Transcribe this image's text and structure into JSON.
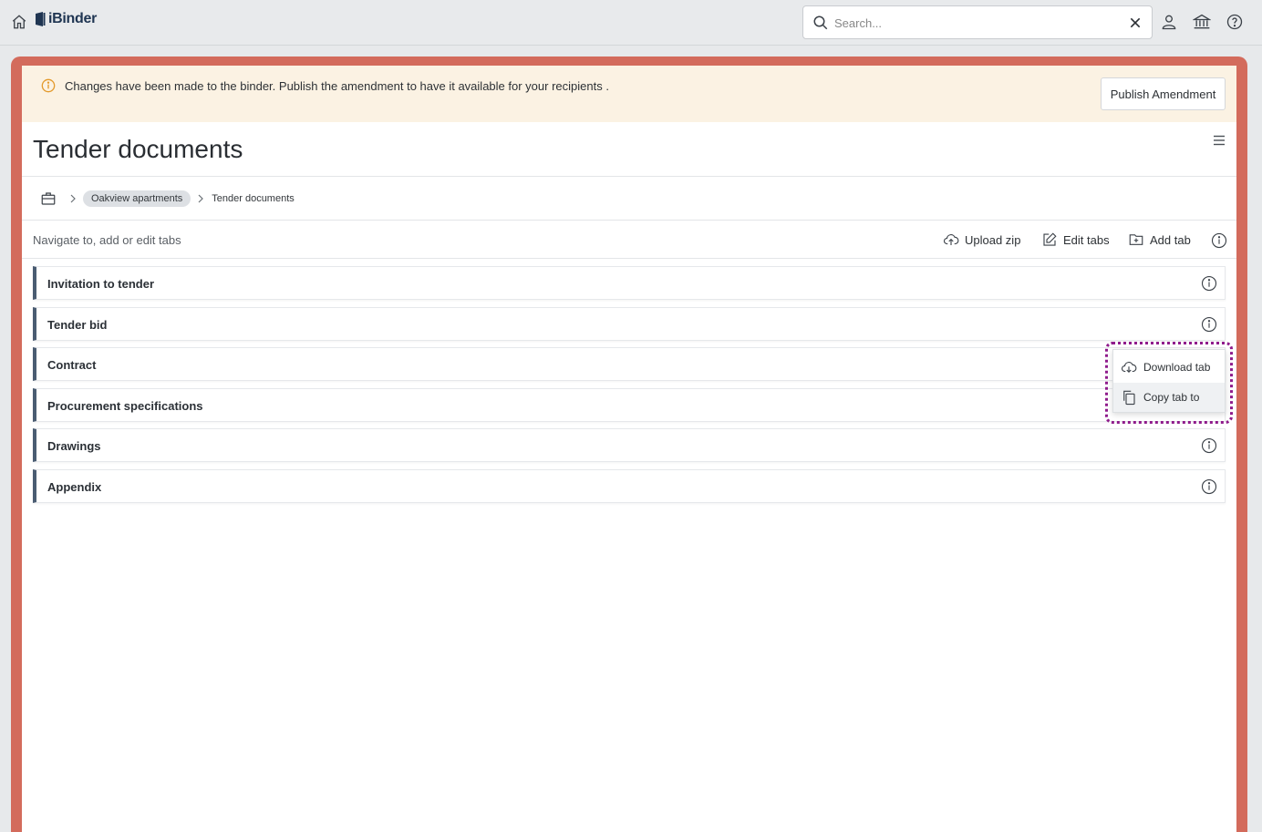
{
  "topbar": {
    "logo_text": "iBinder",
    "search_placeholder": "Search..."
  },
  "notice": {
    "text": "Changes have been made to the binder. Publish the amendment to have it available for your recipients .",
    "publish_label": "Publish Amendment"
  },
  "page": {
    "title": "Tender documents"
  },
  "breadcrumb": {
    "project": "Oakview apartments",
    "current": "Tender documents"
  },
  "toolbar": {
    "nav_label": "Navigate to, add or edit tabs",
    "upload_zip": "Upload zip",
    "edit_tabs": "Edit tabs",
    "add_tab": "Add tab"
  },
  "tabs": [
    {
      "label": "Invitation to tender"
    },
    {
      "label": "Tender bid"
    },
    {
      "label": "Contract"
    },
    {
      "label": "Procurement specifications"
    },
    {
      "label": "Drawings"
    },
    {
      "label": "Appendix"
    }
  ],
  "context_menu": {
    "download_tab": "Download tab",
    "copy_tab_to": "Copy tab to"
  },
  "colors": {
    "frame": "#d36b5c",
    "notice_bg": "#fbf2e3",
    "tab_accent": "#4a5c72",
    "highlight": "#8f1c8c"
  }
}
